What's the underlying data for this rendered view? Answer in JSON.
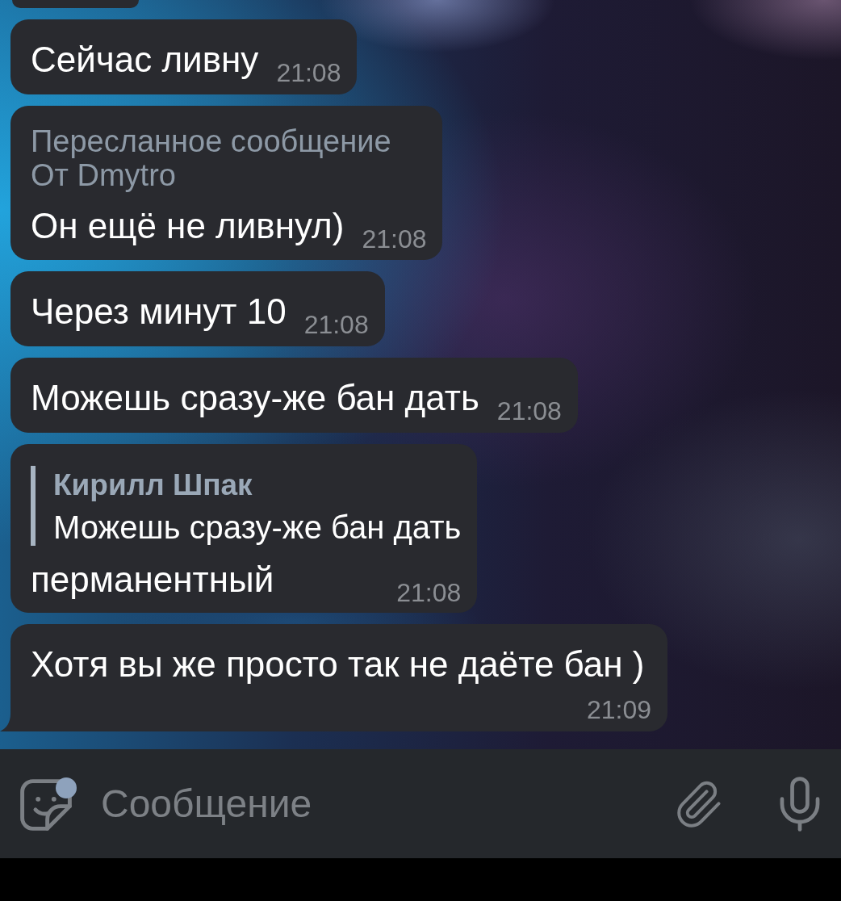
{
  "chat": {
    "messages": [
      {
        "kind": "partial",
        "tail": false
      },
      {
        "kind": "text",
        "text": "Сейчас ливну",
        "time": "21:08",
        "tail": false
      },
      {
        "kind": "forwarded",
        "forward_label": "Пересланное сообщение",
        "forward_from": "От Dmytro",
        "text": "Он ещё не ливнул)",
        "time": "21:08",
        "tail": false
      },
      {
        "kind": "text",
        "text": "Через минут 10",
        "time": "21:08",
        "tail": false
      },
      {
        "kind": "text",
        "text": "Можешь сразу-же бан дать",
        "time": "21:08",
        "tail": false
      },
      {
        "kind": "reply",
        "reply_author": "Кирилл Шпак",
        "reply_text": "Можешь сразу-же бан дать",
        "text": "перманентный",
        "time": "21:08",
        "tail": false
      },
      {
        "kind": "text",
        "text": "Хотя вы же просто так не даёте бан )",
        "time": "21:09",
        "tail": true
      }
    ]
  },
  "composer": {
    "placeholder": "Сообщение",
    "sticker_badge": true
  }
}
